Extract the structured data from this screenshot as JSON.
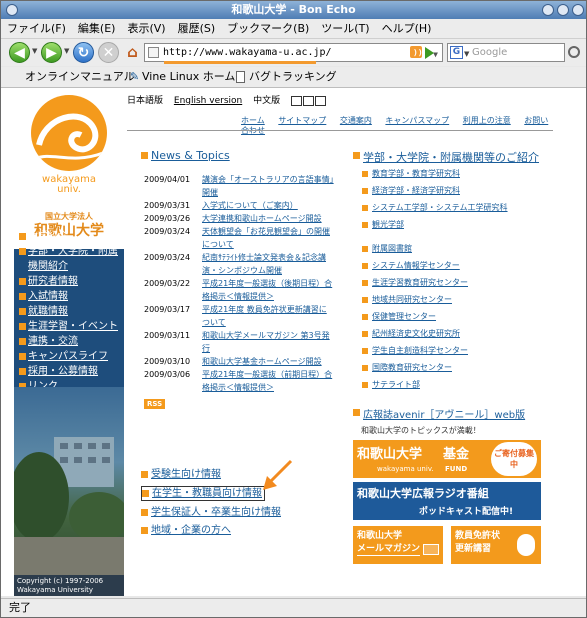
{
  "window": {
    "title": "和歌山大学 - Bon Echo"
  },
  "menu": [
    "ファイル(F)",
    "編集(E)",
    "表示(V)",
    "履歴(S)",
    "ブックマーク(B)",
    "ツール(T)",
    "ヘルプ(H)"
  ],
  "nav": {
    "url": "http://www.wakayama-u.ac.jp/",
    "search_placeholder": "Google"
  },
  "bookmarks": [
    "オンラインマニュアル",
    "Vine Linux ホーム",
    "バグトラッキング"
  ],
  "status": "完了",
  "page": {
    "logo_text": [
      "wakayama",
      "univ."
    ],
    "uni_small": "国立大学法人",
    "uni_big": "和歌山大学",
    "lang_links": [
      "日本語版",
      "English version",
      "中文版"
    ],
    "top_nav": [
      "ホーム",
      "サイトマップ",
      "交通案内",
      "キャンパスマップ",
      "利用上の注意",
      "お問い合わせ"
    ],
    "left_nav": [
      "大学紹介",
      "学部・大学院・附属機関紹介",
      "研究者情報",
      "入試情報",
      "就職情報",
      "生涯学習・イベント",
      "連携・交流",
      "キャンパスライフ",
      "採用・公募情報",
      "リンク"
    ],
    "copyright": "Copyright (c) 1997-2006 Wakayama University",
    "news_title": "News & Topics",
    "news": [
      {
        "date": "2009/04/01",
        "text": "講演会「オーストラリアの言語事情」開催"
      },
      {
        "date": "2009/03/31",
        "text": "入学式について（ご案内）"
      },
      {
        "date": "2009/03/26",
        "text": "大学連携和歌山ホームページ開設"
      },
      {
        "date": "2009/03/24",
        "text": "天体観望会「お花見観望会」の開催について"
      },
      {
        "date": "2009/03/24",
        "text": "紀南ｻﾃﾗｲﾄ修士論文発表会＆記念講演・シンポジウム開催"
      },
      {
        "date": "2009/03/22",
        "text": "平成21年度一般選抜（後期日程）合格掲示＜情報提供＞"
      },
      {
        "date": "2009/03/17",
        "text": "平成21年度 教員免許状更新講習について"
      },
      {
        "date": "2009/03/11",
        "text": "和歌山大学メールマガジン 第3号発行"
      },
      {
        "date": "2009/03/10",
        "text": "和歌山大学基金ホームページ開設"
      },
      {
        "date": "2009/03/06",
        "text": "平成21年度一般選抜（前期日程）合格掲示＜情報提供＞"
      }
    ],
    "rss": "RSS",
    "audience_links": [
      "受験生向け情報",
      "在学生・教職員向け情報",
      "学生保証人・卒業生向け情報",
      "地域・企業の方へ"
    ],
    "right_title": "学部・大学院・附属機関等のご紹介",
    "right_group1": [
      "教育学部・教育学研究科",
      "経済学部・経済学研究科",
      "システム工学部・システム工学研究科",
      "観光学部"
    ],
    "right_group2": [
      "附属図書館",
      "システム情報学センター",
      "生涯学習教育研究センター",
      "地域共同研究センター",
      "保健管理センター",
      "紀州経済史文化史研究所",
      "学生自主創造科学センター",
      "国際教育研究センター",
      "サテライト部"
    ],
    "avenir_title": "広報誌avenir［アヴニール］web版",
    "avenir_sub": "和歌山大学のトピックスが満載！",
    "banners": {
      "fund": [
        "和歌山大学",
        "基金",
        "ご寄付募集中",
        "wakayama univ.",
        "FUND"
      ],
      "radio": [
        "和歌山大学広報ラジオ番組",
        "ポッドキャスト配信中!"
      ],
      "mail": [
        "和歌山大学",
        "メールマガジン"
      ],
      "license": [
        "教員免許状",
        "更新講習"
      ]
    }
  }
}
